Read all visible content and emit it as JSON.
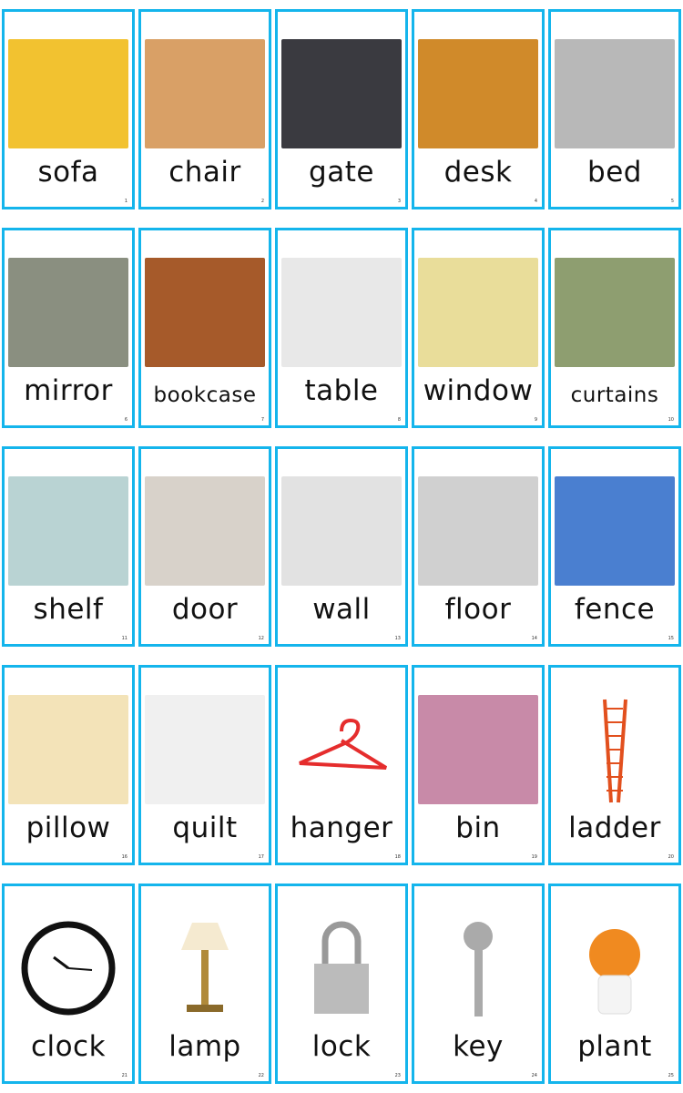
{
  "border_color": "#14b5ec",
  "cards": [
    {
      "number": "1",
      "word": "sofa",
      "icon": "sofa-image",
      "color": "#f2c230"
    },
    {
      "number": "2",
      "word": "chair",
      "icon": "chair-image",
      "color": "#d9a066"
    },
    {
      "number": "3",
      "word": "gate",
      "icon": "gate-image",
      "color": "#3a3a40"
    },
    {
      "number": "4",
      "word": "desk",
      "icon": "desk-image",
      "color": "#d08a2a"
    },
    {
      "number": "5",
      "word": "bed",
      "icon": "bed-image",
      "color": "#b8b8b8"
    },
    {
      "number": "6",
      "word": "mirror",
      "icon": "mirror-image",
      "color": "#8a8f80"
    },
    {
      "number": "7",
      "word": "bookcase",
      "icon": "bookcase-image",
      "color": "#a65a2a"
    },
    {
      "number": "8",
      "word": "table",
      "icon": "table-image",
      "color": "#e8e8e8"
    },
    {
      "number": "9",
      "word": "window",
      "icon": "window-image",
      "color": "#e9dd9a"
    },
    {
      "number": "10",
      "word": "curtains",
      "icon": "curtains-image",
      "color": "#8e9e70"
    },
    {
      "number": "11",
      "word": "shelf",
      "icon": "shelf-image",
      "color": "#b9d3d3"
    },
    {
      "number": "12",
      "word": "door",
      "icon": "door-image",
      "color": "#d8d2ca"
    },
    {
      "number": "13",
      "word": "wall",
      "icon": "wall-image",
      "color": "#e2e2e2"
    },
    {
      "number": "14",
      "word": "floor",
      "icon": "floor-image",
      "color": "#d0d0d0"
    },
    {
      "number": "15",
      "word": "fence",
      "icon": "fence-image",
      "color": "#4a7fd0"
    },
    {
      "number": "16",
      "word": "pillow",
      "icon": "pillow-image",
      "color": "#f3e3b8"
    },
    {
      "number": "17",
      "word": "quilt",
      "icon": "quilt-image",
      "color": "#f0f0f0"
    },
    {
      "number": "18",
      "word": "hanger",
      "icon": "hanger-image",
      "color": "#ffffff"
    },
    {
      "number": "19",
      "word": "bin",
      "icon": "bin-image",
      "color": "#c88aa8"
    },
    {
      "number": "20",
      "word": "ladder",
      "icon": "ladder-image",
      "color": "#ffffff"
    },
    {
      "number": "21",
      "word": "clock",
      "icon": "clock-image",
      "color": "#ffffff"
    },
    {
      "number": "22",
      "word": "lamp",
      "icon": "lamp-image",
      "color": "#ffffff"
    },
    {
      "number": "23",
      "word": "lock",
      "icon": "lock-image",
      "color": "#ffffff"
    },
    {
      "number": "24",
      "word": "key",
      "icon": "key-image",
      "color": "#ffffff"
    },
    {
      "number": "25",
      "word": "plant",
      "icon": "plant-image",
      "color": "#ffffff"
    }
  ]
}
